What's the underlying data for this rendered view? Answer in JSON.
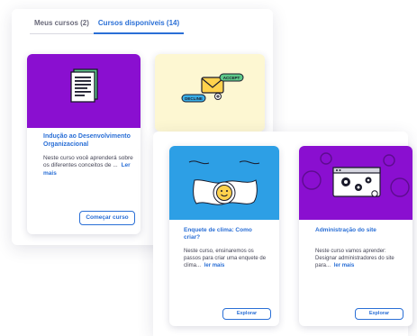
{
  "tabs": [
    {
      "label": "Meus cursos (2)",
      "active": false
    },
    {
      "label": "Cursos disponíveis (14)",
      "active": true
    }
  ],
  "back_cards": [
    {
      "title": "Indução ao Desenvolvimento Organizacional",
      "description": "Neste curso você aprenderá sobre os diferentes conceitos de ...",
      "more_label": "Ler mais",
      "button_label": "Começar curso",
      "hero_color": "#8a0fd0",
      "icon": "document-icon"
    },
    {
      "hero_color": "#fdf7d2",
      "icon": "envelope-accept-decline-icon",
      "accept_label": "ACCEPT",
      "decline_label": "DECLINE"
    }
  ],
  "front_cards": [
    {
      "title": "Enquete de clima: Como criar?",
      "description": "Neste curso, ensinaremos os passos para criar uma enquete de clima...",
      "more_label": "ler mais",
      "button_label": "Explorar",
      "hero_color": "#2d9fe5",
      "icon": "smiley-icon"
    },
    {
      "title": "Administração do site",
      "description": "Neste curso vamos aprender: Designar administradores do site para...",
      "more_label": "ler mais",
      "button_label": "Explorar",
      "hero_color": "#8a0fd0",
      "icon": "browser-gears-icon"
    }
  ],
  "accent_color": "#2a6fd6"
}
